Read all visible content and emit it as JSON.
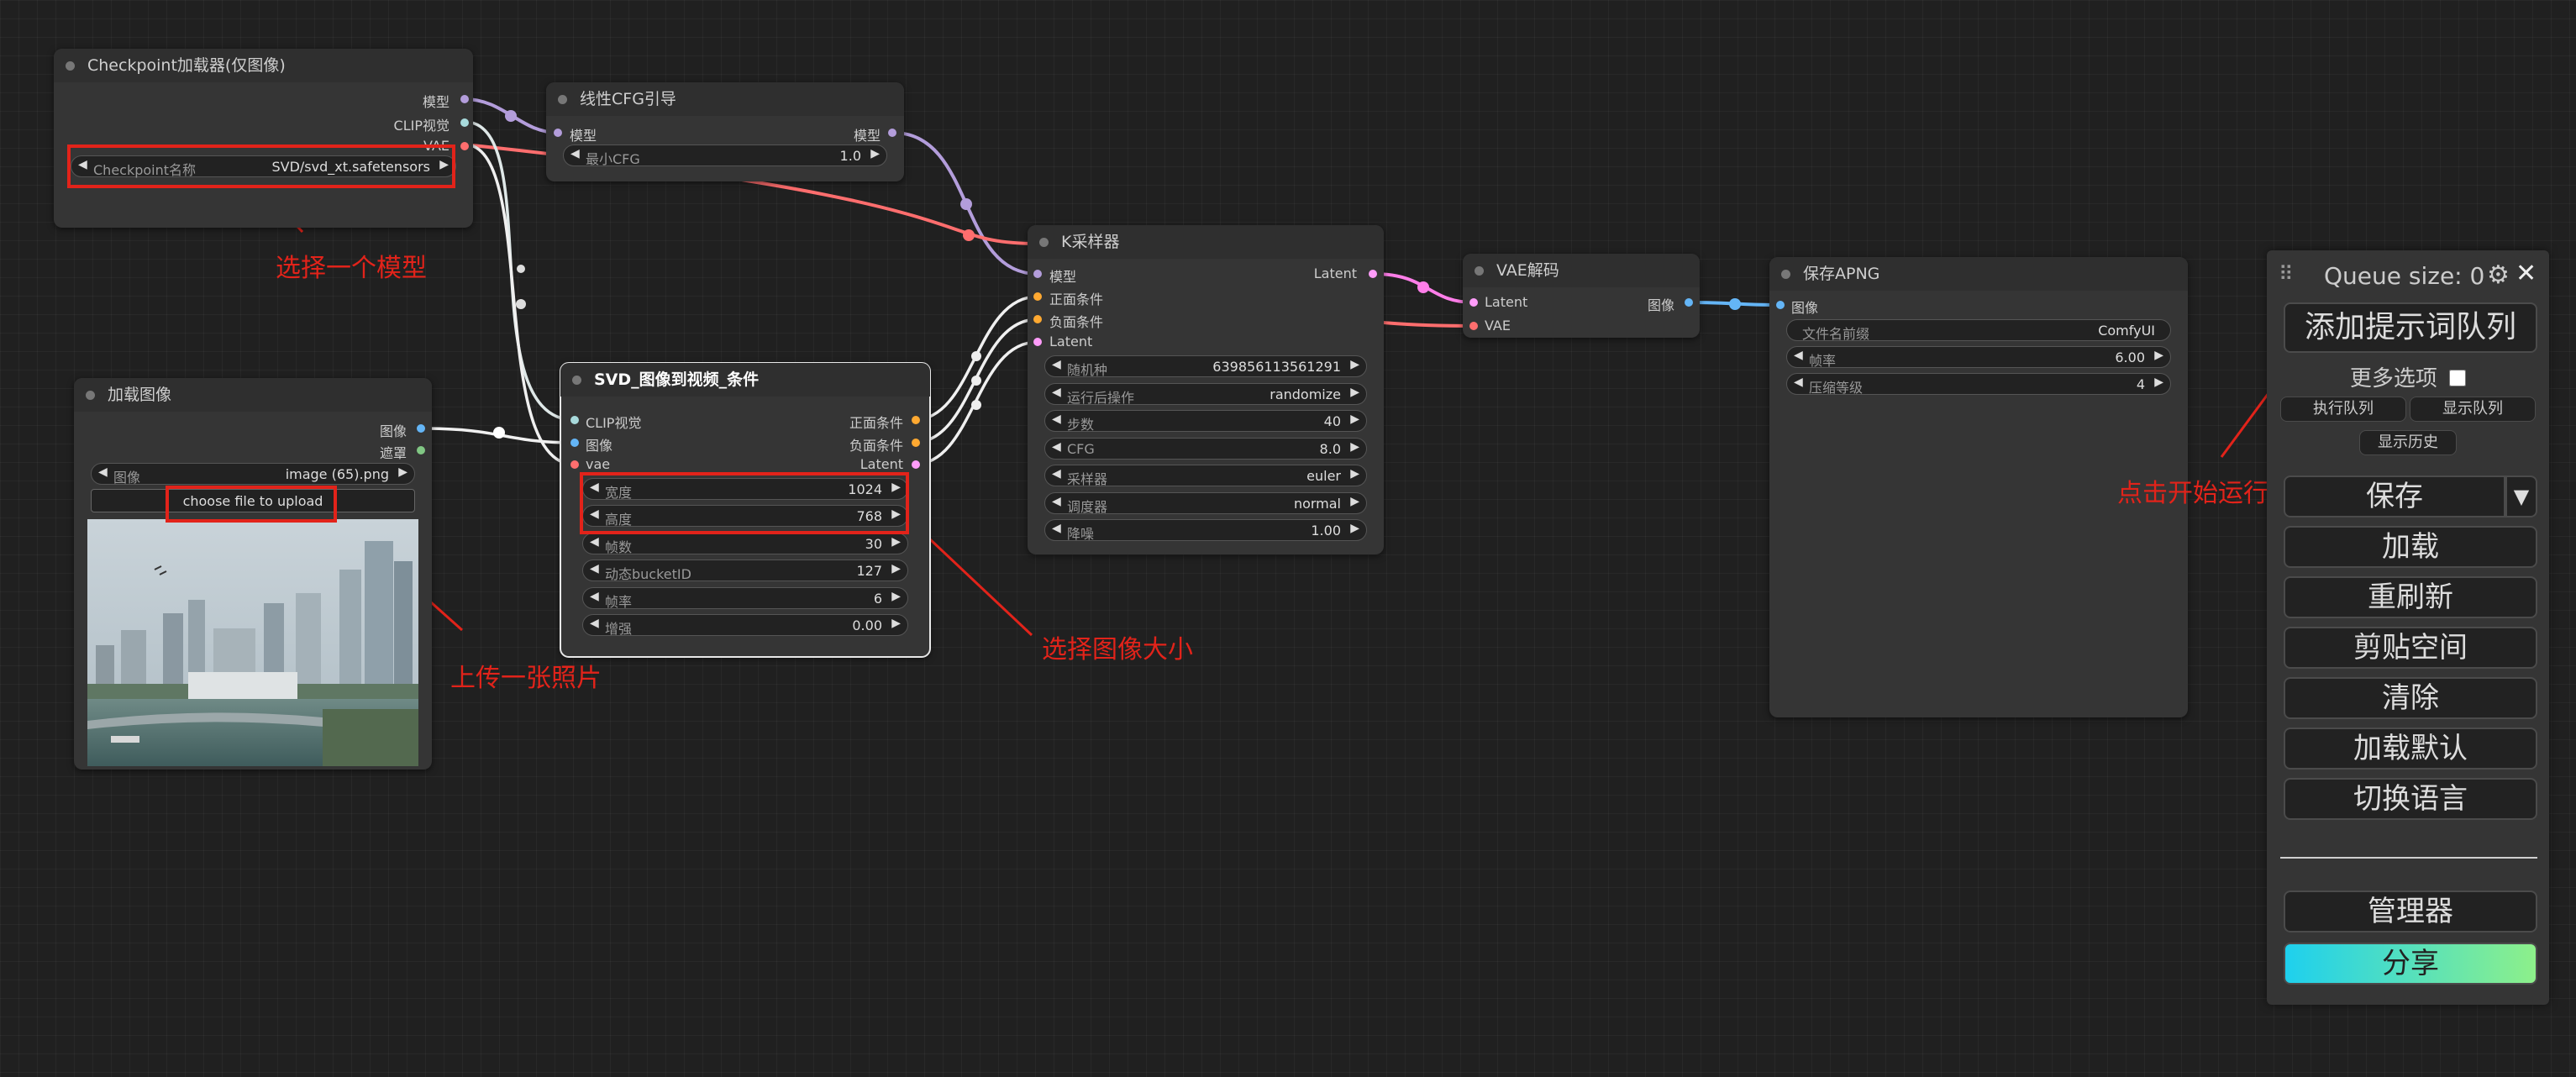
{
  "nodes": {
    "checkpoint": {
      "title": "Checkpoint加载器(仅图像)",
      "outputs": [
        "模型",
        "CLIP视觉",
        "VAE"
      ],
      "widget": {
        "label": "Checkpoint名称",
        "value": "SVD/svd_xt.safetensors"
      }
    },
    "cfg": {
      "title": "线性CFG引导",
      "input": "模型",
      "output": "模型",
      "widget": {
        "label": "最小CFG",
        "value": "1.0"
      }
    },
    "ksampler": {
      "title": "K采样器",
      "inputs": [
        "模型",
        "正面条件",
        "负面条件",
        "Latent"
      ],
      "output": "Latent",
      "widgets": [
        {
          "label": "随机种",
          "value": "639856113561291"
        },
        {
          "label": "运行后操作",
          "value": "randomize"
        },
        {
          "label": "步数",
          "value": "40"
        },
        {
          "label": "CFG",
          "value": "8.0"
        },
        {
          "label": "采样器",
          "value": "euler"
        },
        {
          "label": "调度器",
          "value": "normal"
        },
        {
          "label": "降噪",
          "value": "1.00"
        }
      ]
    },
    "vaedecode": {
      "title": "VAE解码",
      "inputs": [
        "Latent",
        "VAE"
      ],
      "output": "图像"
    },
    "saveapng": {
      "title": "保存APNG",
      "input": "图像",
      "widgets": [
        {
          "label": "文件名前缀",
          "value": "ComfyUI"
        },
        {
          "label": "帧率",
          "value": "6.00"
        },
        {
          "label": "压缩等级",
          "value": "4"
        }
      ]
    },
    "loadimage": {
      "title": "加载图像",
      "outputs": [
        "图像",
        "遮罩"
      ],
      "widget": {
        "label": "图像",
        "value": "image (65).png"
      },
      "upload_label": "choose file to upload"
    },
    "svd": {
      "title": "SVD_图像到视频_条件",
      "inputs": [
        "CLIP视觉",
        "图像",
        "vae"
      ],
      "outputs": [
        "正面条件",
        "负面条件",
        "Latent"
      ],
      "widgets": [
        {
          "label": "宽度",
          "value": "1024"
        },
        {
          "label": "高度",
          "value": "768"
        },
        {
          "label": "帧数",
          "value": "30"
        },
        {
          "label": "动态bucketID",
          "value": "127"
        },
        {
          "label": "帧率",
          "value": "6"
        },
        {
          "label": "增强",
          "value": "0.00"
        }
      ]
    }
  },
  "annotations": {
    "choose_model": "选择一个模型",
    "upload_photo": "上传一张照片",
    "choose_size": "选择图像大小",
    "click_run": "点击开始运行"
  },
  "panel": {
    "drag_handle": "⠿",
    "queue_size": "Queue size: 0",
    "queue_prompt": "添加提示词队列",
    "more_options": "更多选项",
    "execute_queue": "执行队列",
    "show_queue": "显示队列",
    "show_history": "显示历史",
    "save": "保存",
    "save_dropdown": "▼",
    "load": "加载",
    "refresh": "重刷新",
    "clipspace": "剪贴空间",
    "clear": "清除",
    "load_default": "加载默认",
    "switch_language": "切换语言",
    "manager": "管理器",
    "share": "分享"
  },
  "colors": {
    "annotation": "#e2231a",
    "model_wire": "#b39ddb",
    "vae_wire": "#ff6e6e",
    "clip_vision_wire": "#a8dadc",
    "image_wire": "#64b5f6",
    "latent_wire": "#ff9cf9",
    "conditioning_wire": "#ffa931"
  }
}
